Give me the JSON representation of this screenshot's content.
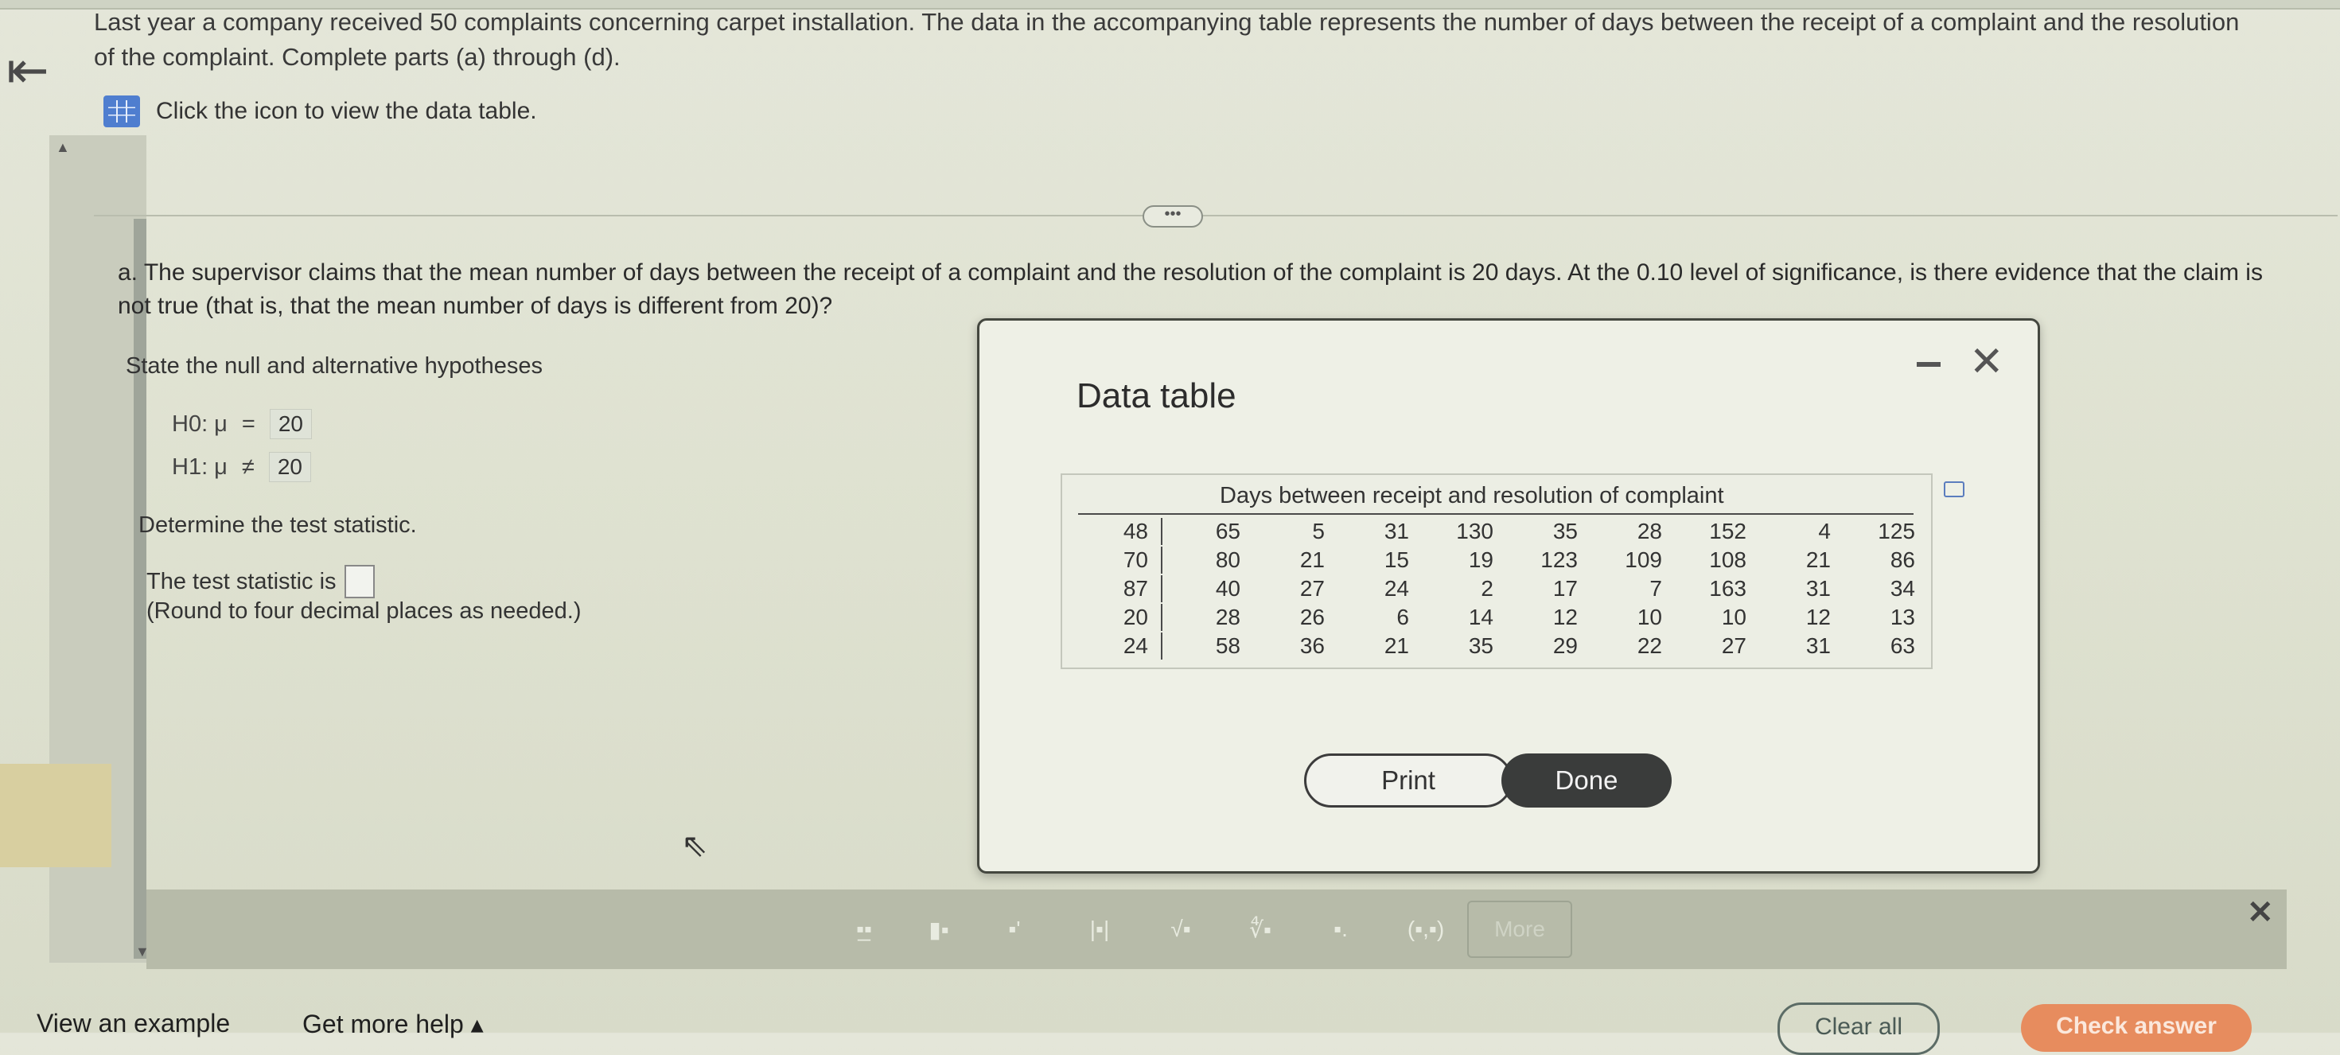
{
  "intro": {
    "text": "Last year a company received 50 complaints concerning carpet installation. The data in the accompanying table represents the number of days between the receipt of a complaint and the resolution of the complaint. Complete parts (a) through (d).",
    "table_link": "Click the icon to view the data table."
  },
  "expand_label": "•••",
  "question": {
    "text": "a. The supervisor claims that the mean number of days between the receipt of a complaint and the resolution of the complaint is 20 days. At the 0.10 level of significance, is there evidence that the claim is not true (that is, that the mean number of days is different from 20)?",
    "hypotheses_label": "State the null and alternative hypotheses",
    "h0": {
      "label": "H0: μ",
      "op": "=",
      "value": "20"
    },
    "h1": {
      "label": "H1: μ",
      "op": "≠",
      "value": "20"
    },
    "determine_label": "Determine the test statistic.",
    "test_statistic_label": "The test statistic is",
    "round_note": "(Round to four decimal places as needed.)"
  },
  "modal": {
    "title": "Data table",
    "caption": "Days between receipt and resolution of complaint",
    "rows": [
      [
        "48",
        "65",
        "5",
        "31",
        "130",
        "35",
        "28",
        "152",
        "4",
        "125"
      ],
      [
        "70",
        "80",
        "21",
        "15",
        "19",
        "123",
        "109",
        "108",
        "21",
        "86"
      ],
      [
        "87",
        "40",
        "27",
        "24",
        "2",
        "17",
        "7",
        "163",
        "31",
        "34"
      ],
      [
        "20",
        "28",
        "26",
        "6",
        "14",
        "12",
        "10",
        "10",
        "12",
        "13"
      ],
      [
        "24",
        "58",
        "36",
        "21",
        "35",
        "29",
        "22",
        "27",
        "31",
        "63"
      ]
    ],
    "print_label": "Print",
    "done_label": "Done"
  },
  "toolbar": {
    "tools": [
      "fraction",
      "mixed-number",
      "exponent",
      "absolute-value",
      "sqrt",
      "nth-root",
      "decimal",
      "ordered-pair"
    ],
    "more_label": "More"
  },
  "footer": {
    "view_example": "View an example",
    "get_help": "Get more help ▴",
    "clear_all": "Clear all",
    "check_answer": "Check answer"
  }
}
